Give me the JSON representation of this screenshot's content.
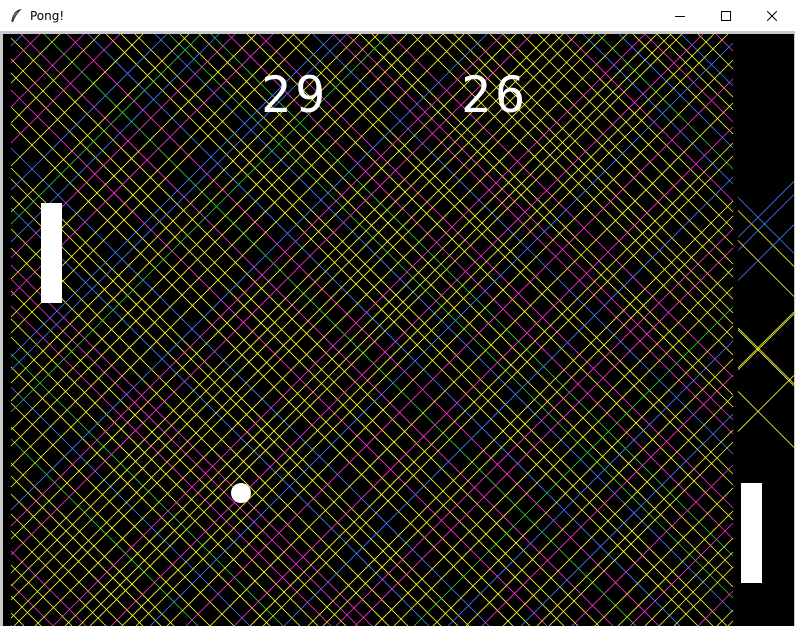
{
  "window": {
    "title": "Pong!",
    "icon": "feather-icon",
    "controls": [
      "minimize-icon",
      "maximize-icon",
      "close-icon"
    ]
  },
  "game": {
    "score_left": "29",
    "score_right": "26",
    "background_color": "#000000",
    "paddle_color": "#ffffff",
    "ball_color": "#ffffff",
    "trail_colors": [
      "#ffff33",
      "#3f7fff",
      "#ff33cc",
      "#33cc33"
    ]
  }
}
